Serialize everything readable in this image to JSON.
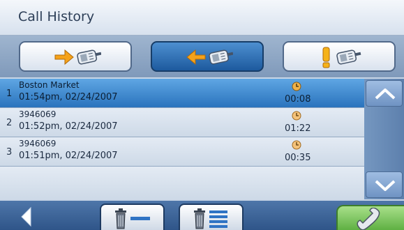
{
  "header": {
    "title": "Call History"
  },
  "tabs": [
    {
      "id": "outgoing",
      "icon": "outgoing-call-icon",
      "active": false
    },
    {
      "id": "incoming",
      "icon": "incoming-call-icon",
      "active": true
    },
    {
      "id": "missed",
      "icon": "missed-call-icon",
      "active": false
    }
  ],
  "calls": [
    {
      "number": "1",
      "name": "Boston Market",
      "time": "01:54pm, 02/24/2007",
      "duration": "00:08",
      "selected": true
    },
    {
      "number": "2",
      "name": "3946069",
      "time": "01:52pm, 02/24/2007",
      "duration": "01:22",
      "selected": false
    },
    {
      "number": "3",
      "name": "3946069",
      "time": "01:51pm, 02/24/2007",
      "duration": "00:35",
      "selected": false
    }
  ],
  "colors": {
    "accent": "#2a73bd",
    "arrow": "#f5a21a",
    "call_green": "#5fb043"
  },
  "toolbar": {
    "back_icon": "back-arrow-icon",
    "delete_one_icon": "delete-entry-icon",
    "delete_all_icon": "delete-all-icon",
    "call_icon": "phone-handset-icon"
  }
}
